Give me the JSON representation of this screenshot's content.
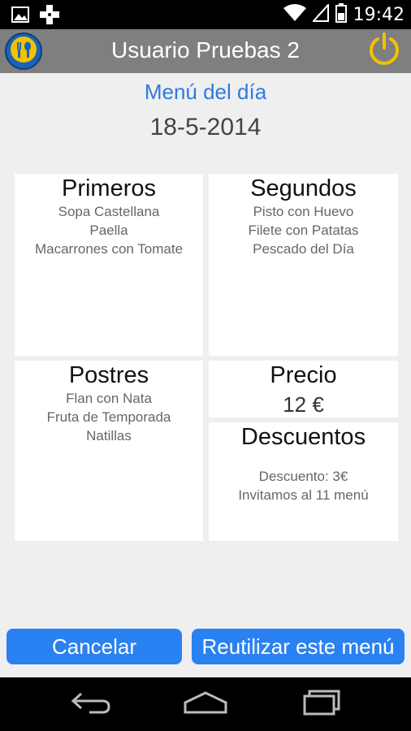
{
  "status_bar": {
    "icons": [
      "image-icon",
      "gamepad-icon",
      "wifi-icon",
      "signal-icon",
      "battery-icon"
    ],
    "time": "19:42"
  },
  "action_bar": {
    "title": "Usuario Pruebas 2",
    "logo_icon": "fork-spoon-icon",
    "power_icon": "power-icon",
    "accent": "#f2c200"
  },
  "header": {
    "title": "Menú del día",
    "date": "18-5-2014"
  },
  "sections": {
    "primeros": {
      "title": "Primeros",
      "items": [
        "Sopa Castellana",
        "Paella",
        "Macarrones con Tomate"
      ]
    },
    "segundos": {
      "title": "Segundos",
      "items": [
        "Pisto con Huevo",
        "Filete con Patatas",
        "Pescado del Día"
      ]
    },
    "postres": {
      "title": "Postres",
      "items": [
        "Flan con Nata",
        "Fruta de Temporada",
        "Natillas"
      ]
    },
    "precio": {
      "title": "Precio",
      "value": "12 €"
    },
    "descuentos": {
      "title": "Descuentos",
      "items": [
        "Descuento: 3€",
        "Invitamos al 11 menú"
      ]
    }
  },
  "buttons": {
    "cancel": "Cancelar",
    "reuse": "Reutilizar este menú"
  },
  "colors": {
    "button": "#2a81f1",
    "title_blue": "#2d7be0",
    "action_bar": "#7f7f7f"
  }
}
